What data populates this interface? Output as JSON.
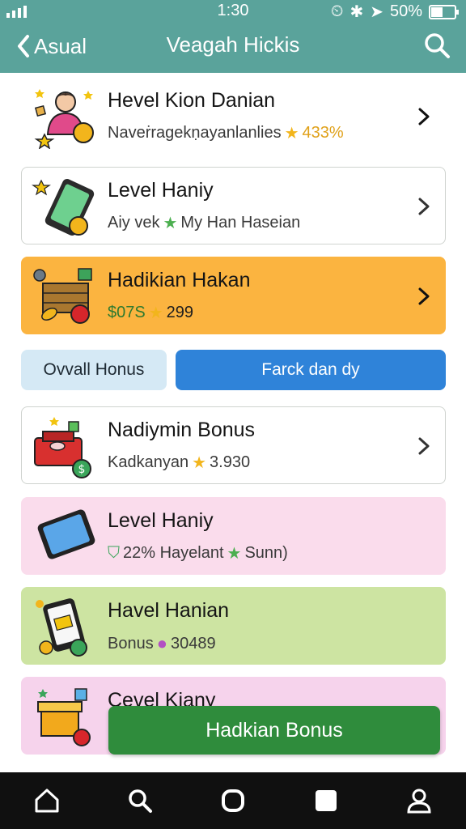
{
  "status_bar": {
    "time": "1:30",
    "battery": "50%",
    "battery_level": 0.5
  },
  "header": {
    "back_label": "Asual",
    "title": "Veagah Hickis"
  },
  "cards_top": [
    {
      "title": "Hevel Kion Danian",
      "subtitle": "Naveṙragekṇayanlanlies",
      "value": "433%",
      "bg": "#ffffff",
      "border": "#ffffff"
    },
    {
      "title": "Level Haniy",
      "subtitle": "Aiy vek",
      "value": "My Han Haseian",
      "bg": "#ffffff",
      "border": "#cfd3cf"
    },
    {
      "title": "Hadikian Hakan",
      "subtitle": "$07S",
      "value": "299",
      "bg": "#fbb440",
      "border": "#fbb440"
    }
  ],
  "toggle": {
    "left": "Ovvall Honus",
    "right": "Farck dan dy"
  },
  "cards_bottom": [
    {
      "title": "Nadiymin Bonus",
      "subtitle": "Kadkanyan",
      "value": "3.930",
      "bg": "#ffffff",
      "border": "#cfd3cf"
    },
    {
      "title": "Level Haniy",
      "subtitle": "22%  Hayelant",
      "value": "Sunn)",
      "bg": "#fadcec",
      "border": "#fadcec"
    },
    {
      "title": "Havel Hanian",
      "subtitle": "Bonus",
      "value": "30489",
      "bg": "#cde4a2",
      "border": "#cde4a2"
    },
    {
      "title": "Cevel Kiany",
      "bg": "#f6d3ec",
      "border": "#f6d3ec"
    }
  ],
  "cta": {
    "label": "Hadkian Bonus"
  },
  "bottom_nav": [
    {
      "icon": "home-icon"
    },
    {
      "icon": "search-icon"
    },
    {
      "icon": "circle-icon"
    },
    {
      "icon": "square-icon"
    },
    {
      "icon": "profile-icon"
    }
  ],
  "colors": {
    "header": "#5aa39b",
    "accent_blue": "#2f83d9",
    "accent_green": "#2f8c3c",
    "orange": "#fbb440"
  }
}
